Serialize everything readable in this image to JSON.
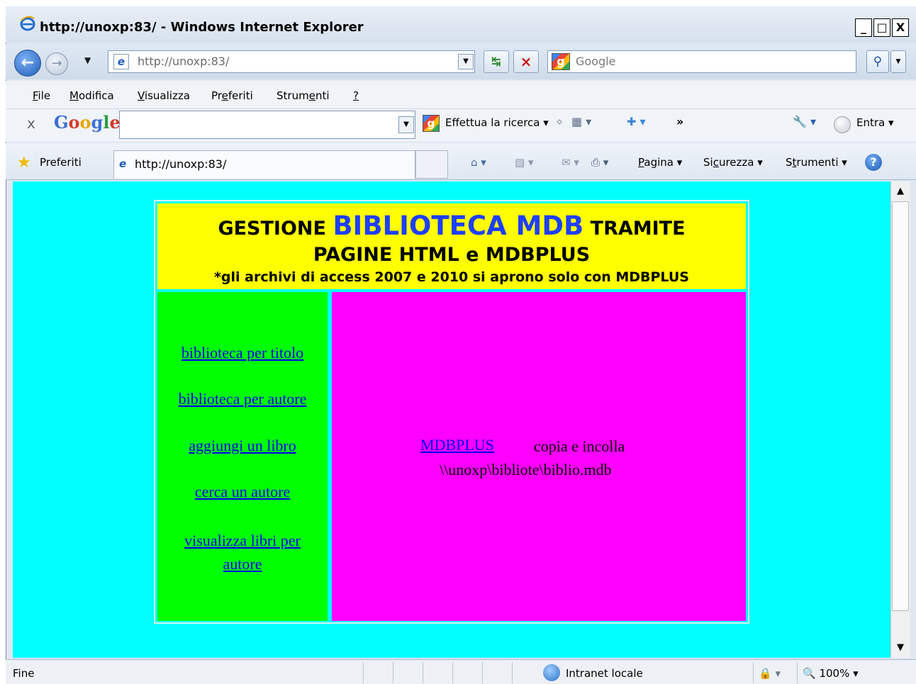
{
  "window": {
    "title": "http://unoxp:83/ - Windows Internet Explorer",
    "buttons": {
      "minimize": "_",
      "maximize": "□",
      "close": "X"
    }
  },
  "address_bar": {
    "url": "http://unoxp:83/",
    "search_placeholder": "Google"
  },
  "menu": {
    "items": [
      {
        "pre": "",
        "u": "F",
        "post": "ile"
      },
      {
        "pre": "",
        "u": "M",
        "post": "odifica"
      },
      {
        "pre": "",
        "u": "V",
        "post": "isualizza"
      },
      {
        "pre": "Pr",
        "u": "e",
        "post": "feriti"
      },
      {
        "pre": "Strum",
        "u": "e",
        "post": "nti"
      },
      {
        "pre": "",
        "u": "?",
        "post": ""
      }
    ]
  },
  "google_toolbar": {
    "close": "x",
    "logo": [
      "G",
      "o",
      "o",
      "g",
      "l",
      "e"
    ],
    "search_label": "Effettua la ricerca",
    "more": "»",
    "signin": "Entra"
  },
  "favorites_bar": {
    "favorites_label": "Preferiti",
    "tab_title": "http://unoxp:83/",
    "commands": [
      {
        "pre": "",
        "u": "P",
        "post": "agina"
      },
      {
        "pre": "Si",
        "u": "c",
        "post": "urezza"
      },
      {
        "pre": "S",
        "u": "t",
        "post": "rumenti"
      }
    ]
  },
  "page": {
    "header_line1_pre": "GESTIONE",
    "header_line1_big": "BIBLIOTECA MDB",
    "header_line1_post": "TRAMITE",
    "header_line2": "PAGINE HTML e MDBPLUS",
    "header_line3": "*gli archivi di access 2007 e 2010 si aprono solo con MDBPLUS",
    "nav_links": [
      "biblioteca per titolo",
      "biblioteca per autore",
      "aggiungi un libro",
      "cerca un autore",
      "visualizza libri per autore"
    ],
    "mdbplus_link": "MDBPLUS",
    "copy_text": "copia e incolla",
    "path_text": "\\\\unoxp\\bibliote\\biblio.mdb"
  },
  "status_bar": {
    "status": "Fine",
    "zone": "Intranet locale",
    "zoom": "100%"
  },
  "colors": {
    "page_bg": "#00ffff",
    "header_bg": "#ffff00",
    "nav_bg": "#00ff00",
    "content_bg": "#ff00ff",
    "link": "#0000ee",
    "title_blue": "#1e3fff"
  }
}
